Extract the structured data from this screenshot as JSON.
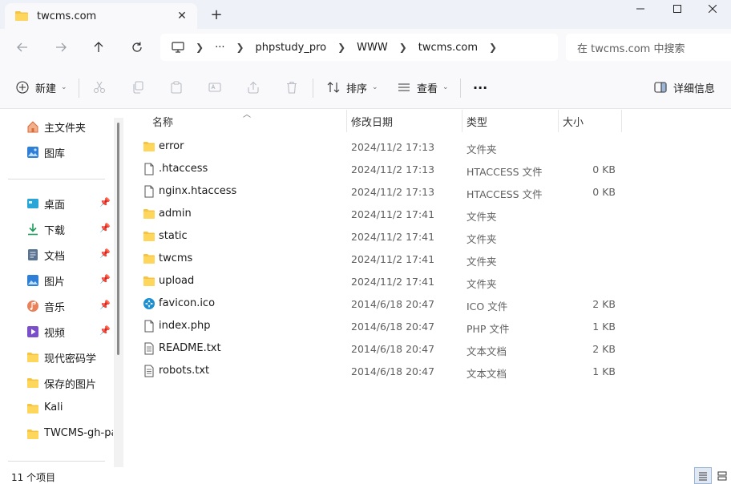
{
  "window": {
    "tab_title": "twcms.com",
    "tab_close": "✕",
    "new_tab": "+",
    "minimize": "—",
    "maximize": "☐",
    "close": "✕"
  },
  "nav": {
    "back_icon": "arrow-left-icon",
    "forward_icon": "arrow-right-icon",
    "up_icon": "arrow-up-icon",
    "refresh_icon": "refresh-icon",
    "ellipsis": "···",
    "breadcrumbs": [
      "phpstudy_pro",
      "WWW",
      "twcms.com"
    ],
    "search_placeholder": "在 twcms.com 中搜索"
  },
  "commands": {
    "new_label": "新建",
    "sort_label": "排序",
    "view_label": "查看",
    "more_label": "···",
    "details_label": "详细信息"
  },
  "sidebar": {
    "top_items": [
      {
        "label": "主文件夹",
        "icon": "home-icon"
      },
      {
        "label": "图库",
        "icon": "gallery-icon"
      }
    ],
    "pinned_items": [
      {
        "label": "桌面",
        "icon": "desktop-icon"
      },
      {
        "label": "下载",
        "icon": "download-icon"
      },
      {
        "label": "文档",
        "icon": "document-icon"
      },
      {
        "label": "图片",
        "icon": "pictures-icon"
      },
      {
        "label": "音乐",
        "icon": "music-icon"
      },
      {
        "label": "视频",
        "icon": "video-icon"
      }
    ],
    "folders": [
      {
        "label": "现代密码学"
      },
      {
        "label": "保存的图片"
      },
      {
        "label": "Kali"
      },
      {
        "label": "TWCMS-gh-pa"
      }
    ]
  },
  "columns": {
    "name": "名称",
    "modified": "修改日期",
    "type": "类型",
    "size": "大小"
  },
  "files": [
    {
      "name": "error",
      "date": "2024/11/2 17:13",
      "type": "文件夹",
      "size": "",
      "icon": "folder-icon"
    },
    {
      "name": ".htaccess",
      "date": "2024/11/2 17:13",
      "type": "HTACCESS 文件",
      "size": "0 KB",
      "icon": "file-icon"
    },
    {
      "name": "nginx.htaccess",
      "date": "2024/11/2 17:13",
      "type": "HTACCESS 文件",
      "size": "0 KB",
      "icon": "file-icon"
    },
    {
      "name": "admin",
      "date": "2024/11/2 17:41",
      "type": "文件夹",
      "size": "",
      "icon": "folder-icon"
    },
    {
      "name": "static",
      "date": "2024/11/2 17:41",
      "type": "文件夹",
      "size": "",
      "icon": "folder-icon"
    },
    {
      "name": "twcms",
      "date": "2024/11/2 17:41",
      "type": "文件夹",
      "size": "",
      "icon": "folder-icon"
    },
    {
      "name": "upload",
      "date": "2024/11/2 17:41",
      "type": "文件夹",
      "size": "",
      "icon": "folder-icon"
    },
    {
      "name": "favicon.ico",
      "date": "2014/6/18 20:47",
      "type": "ICO 文件",
      "size": "2 KB",
      "icon": "ico-file-icon"
    },
    {
      "name": "index.php",
      "date": "2014/6/18 20:47",
      "type": "PHP 文件",
      "size": "1 KB",
      "icon": "file-icon"
    },
    {
      "name": "README.txt",
      "date": "2014/6/18 20:47",
      "type": "文本文档",
      "size": "2 KB",
      "icon": "text-file-icon"
    },
    {
      "name": "robots.txt",
      "date": "2014/6/18 20:47",
      "type": "文本文档",
      "size": "1 KB",
      "icon": "text-file-icon"
    }
  ],
  "status": {
    "count": "11 个项目"
  },
  "colors": {
    "folder": "#f4c542",
    "accent": "#0067c0",
    "titlebar_bg": "#eef1f8"
  }
}
